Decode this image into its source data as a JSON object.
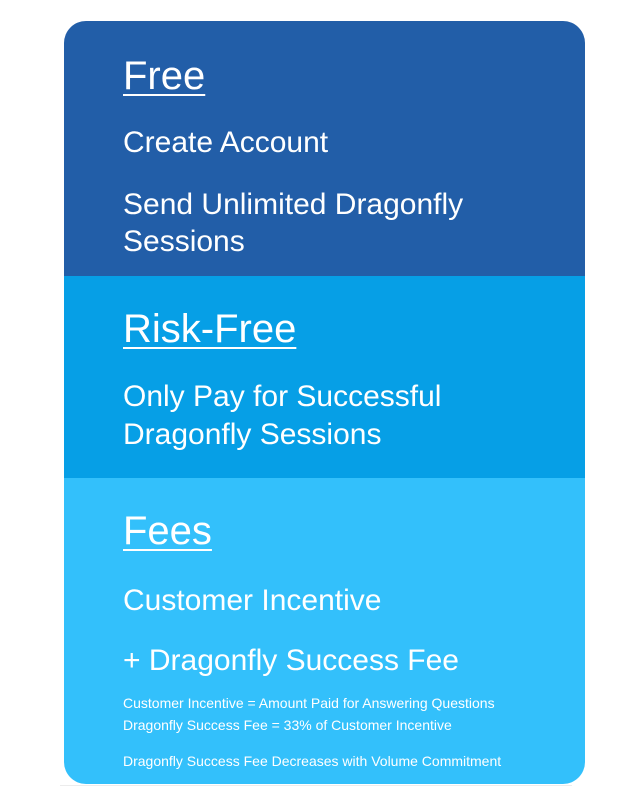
{
  "free": {
    "heading": "Free",
    "line1": "Create Account",
    "line2a": "Send Unlimited Dragonfly",
    "line2b": "Sessions"
  },
  "risk_free": {
    "heading": "Risk-Free",
    "line1a": "Only Pay for Successful",
    "line1b": "Dragonfly Sessions"
  },
  "fees": {
    "heading": "Fees",
    "line1": "Customer Incentive",
    "line2": "+ Dragonfly Success Fee",
    "note1": "Customer Incentive = Amount Paid for Answering Questions",
    "note2": "Dragonfly Success Fee = 33% of Customer Incentive",
    "note3": "Dragonfly Success Fee Decreases with Volume Commitment"
  },
  "colors": {
    "free_bg": "#225ea8",
    "risk_free_bg": "#069fe6",
    "fees_bg": "#33c0fb",
    "text": "#ffffff"
  }
}
